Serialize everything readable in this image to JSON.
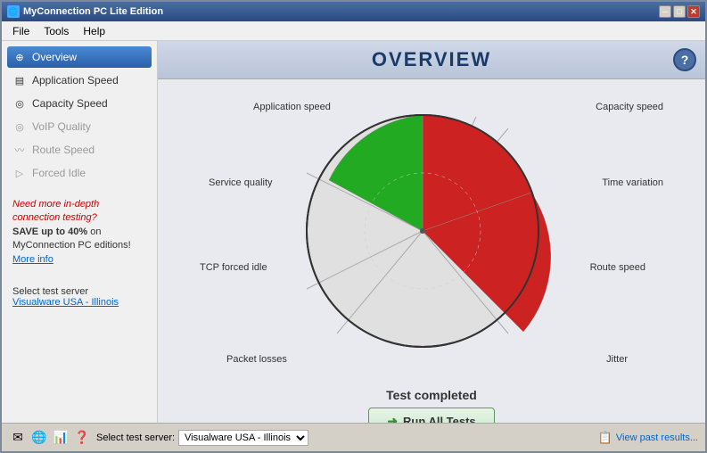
{
  "window": {
    "title": "MyConnection PC Lite Edition",
    "titlebar_icon": "🌐"
  },
  "titlebar_buttons": {
    "minimize": "─",
    "maximize": "□",
    "close": "✕"
  },
  "menubar": {
    "items": [
      "File",
      "Tools",
      "Help"
    ]
  },
  "header": {
    "title": "OVERVIEW",
    "help_label": "?"
  },
  "sidebar": {
    "items": [
      {
        "id": "overview",
        "label": "Overview",
        "active": true,
        "icon": "⊕"
      },
      {
        "id": "application-speed",
        "label": "Application Speed",
        "active": false,
        "icon": "▤"
      },
      {
        "id": "capacity-speed",
        "label": "Capacity Speed",
        "active": false,
        "icon": "◎"
      },
      {
        "id": "voip-quality",
        "label": "VoIP Quality",
        "active": false,
        "disabled": true,
        "icon": "◎"
      },
      {
        "id": "route-speed",
        "label": "Route Speed",
        "active": false,
        "disabled": true,
        "icon": "〰"
      },
      {
        "id": "forced-idle",
        "label": "Forced Idle",
        "active": false,
        "disabled": true,
        "icon": "▷"
      }
    ],
    "promo": {
      "line1": "Need more in-depth connection testing?",
      "line2": "SAVE up to 40%",
      "line3": " on MyConnection PC editions! ",
      "more_info": "More info"
    },
    "server_label": "Select test server",
    "server_link": "Visualware USA - Illinois"
  },
  "chart": {
    "labels": {
      "application_speed": "Application speed",
      "capacity_speed": "Capacity speed",
      "service_quality": "Service quality",
      "time_variation": "Time variation",
      "tcp_forced_idle": "TCP forced idle",
      "route_speed": "Route speed",
      "packet_losses": "Packet losses",
      "jitter": "Jitter"
    },
    "segments": [
      {
        "name": "application_speed",
        "color": "#cc2222",
        "startAngle": -90,
        "endAngle": -15
      },
      {
        "name": "capacity_speed",
        "color": "#cc2222",
        "startAngle": -15,
        "endAngle": 60
      },
      {
        "name": "service_quality",
        "color": "#22aa22",
        "startAngle": -165,
        "endAngle": -90
      },
      {
        "name": "time_variation",
        "color": "#dddddd",
        "startAngle": 60,
        "endAngle": 120
      },
      {
        "name": "tcp_forced_idle",
        "color": "#dddddd",
        "startAngle": 165,
        "endAngle": 195
      },
      {
        "name": "route_speed",
        "color": "#dddddd",
        "startAngle": 120,
        "endAngle": 165
      },
      {
        "name": "packet_losses",
        "color": "#dddddd",
        "startAngle": 195,
        "endAngle": 255
      },
      {
        "name": "jitter",
        "color": "#dddddd",
        "startAngle": 255,
        "endAngle": 300
      }
    ]
  },
  "test_completed": {
    "label": "Test completed",
    "run_all_button": "Run All Tests",
    "run_icon": "➜"
  },
  "bottombar": {
    "server_label": "Select test server:",
    "server_value": "Visualware USA - Illinois",
    "view_results": "View past results...",
    "icons": [
      "✉",
      "🌐",
      "📊",
      "❓"
    ]
  }
}
